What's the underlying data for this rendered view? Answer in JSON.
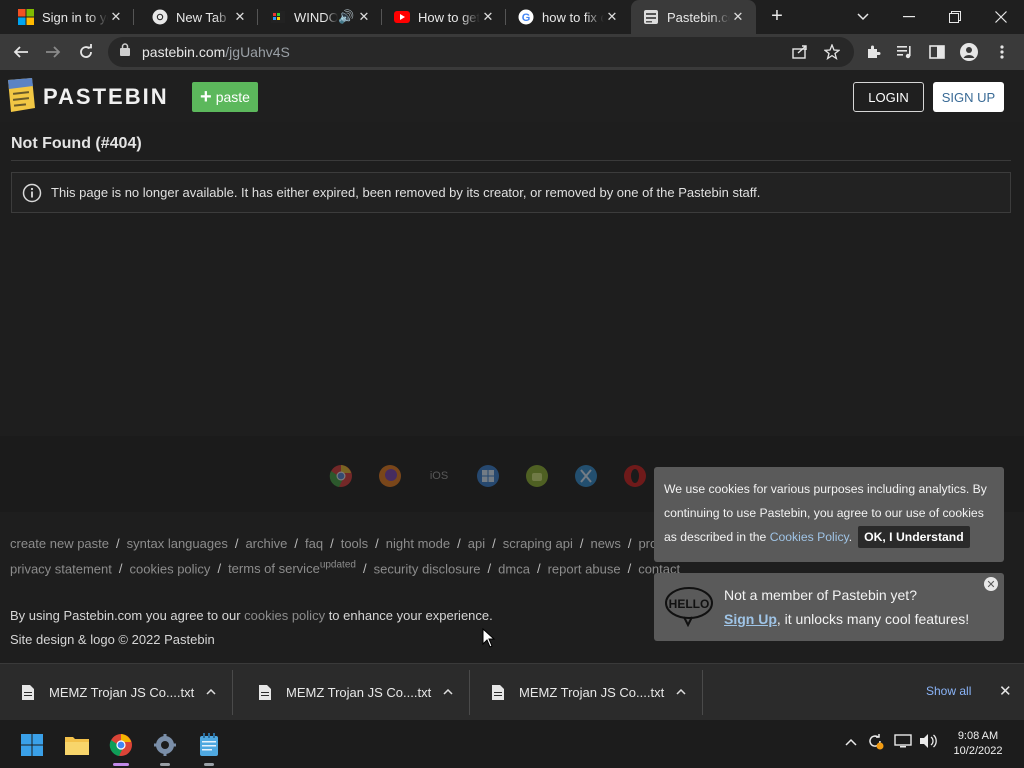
{
  "browser": {
    "tabs": [
      {
        "title": "Sign in to your",
        "icon": "microsoft-icon"
      },
      {
        "title": "New Tab",
        "icon": "chrome-icon"
      },
      {
        "title": "WINDOWS",
        "icon": "windows-tab-icon"
      },
      {
        "title": "How to get",
        "icon": "youtube-icon"
      },
      {
        "title": "how to fix c",
        "icon": "google-icon"
      },
      {
        "title": "Pastebin.com",
        "icon": "pastebin-icon"
      }
    ],
    "url_host": "pastebin.com",
    "url_path": "/jgUahv4S"
  },
  "site": {
    "logo_text": "PASTEBIN",
    "paste_label": "paste",
    "login_label": "LOGIN",
    "signup_label": "SIGN UP"
  },
  "content": {
    "title": "Not Found (#404)",
    "message": "This page is no longer available. It has either expired, been removed by its creator, or removed by one of the Pastebin staff."
  },
  "apps": [
    {
      "name": "chrome",
      "label": ""
    },
    {
      "name": "firefox",
      "label": ""
    },
    {
      "name": "ios",
      "label": "iOS"
    },
    {
      "name": "windows",
      "label": ""
    },
    {
      "name": "android",
      "label": ""
    },
    {
      "name": "mac",
      "label": ""
    },
    {
      "name": "opera",
      "label": ""
    }
  ],
  "footer": {
    "row1": [
      "create new paste",
      "syntax languages",
      "archive",
      "faq",
      "tools",
      "night mode",
      "api",
      "scraping api",
      "news",
      "pro"
    ],
    "row2_a": [
      "privacy statement",
      "cookies policy"
    ],
    "terms": "terms of service",
    "terms_sup": "updated",
    "row2_b": [
      "security disclosure",
      "dmca",
      "report abuse",
      "contact"
    ],
    "agree_prefix": "By using Pastebin.com you agree to our ",
    "agree_link": "cookies policy",
    "agree_suffix": " to enhance your experience.",
    "copyright": "Site design & logo © 2022 Pastebin"
  },
  "cookie": {
    "text": "We use cookies for various purposes including analytics. By continuing to use Pastebin, you agree to our use of cookies as described in the ",
    "link": "Cookies Policy",
    "dot": ".",
    "ok": "OK, I Understand"
  },
  "member": {
    "line1": "Not a member of Pastebin yet?",
    "signup": "Sign Up",
    "line2": ", it unlocks many cool features!"
  },
  "downloads": {
    "items": [
      "MEMZ Trojan JS Co....txt",
      "MEMZ Trojan JS Co....txt",
      "MEMZ Trojan JS Co....txt"
    ],
    "show_all": "Show all"
  },
  "taskbar": {
    "time": "9:08 AM",
    "date": "10/2/2022"
  },
  "colors": {
    "paste_green": "#5cb85c",
    "page_bg": "#1e1e1e",
    "link_blue": "#9fc4e6"
  }
}
